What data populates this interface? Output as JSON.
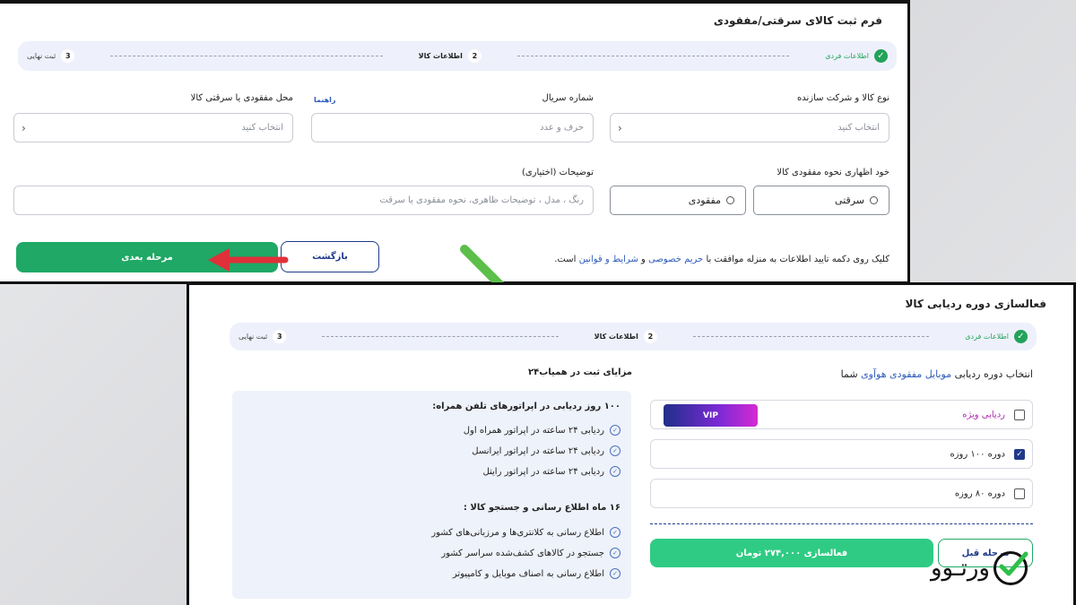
{
  "form1": {
    "title": "فرم ثبت کالای سرقتی/مفقودی",
    "steps": [
      {
        "num": "✓",
        "label": "اطلاعات فردی",
        "state": "done"
      },
      {
        "num": "2",
        "label": "اطلاعات کالا",
        "state": "active"
      },
      {
        "num": "3",
        "label": "ثبت نهایی",
        "state": "pending"
      }
    ],
    "fields": {
      "product_type": {
        "label": "نوع کالا و شرکت سازنده",
        "placeholder": "انتخاب کنید"
      },
      "serial": {
        "label": "شماره سریال",
        "placeholder": "حرف و عدد",
        "help": "راهنما"
      },
      "location": {
        "label": "محل مفقودی یا سرقتی کالا",
        "placeholder": "انتخاب کنید"
      },
      "loss_type": {
        "label": "خود اظهاری نحوه مفقودی کالا",
        "options": [
          "سرقتی",
          "مفقودی"
        ]
      },
      "description": {
        "label": "توضیحات (اختیاری)",
        "placeholder": "رنگ ، مدل ، توضیحات ظاهری، نحوه مفقودی یا سرقت"
      }
    },
    "consent": {
      "prefix": "کلیک روی دکمه تایید اطلاعات به منزله موافقت با",
      "privacy": "حریم خصوصی",
      "and": "و",
      "terms": "شرایط و قوانین",
      "suffix": "است."
    },
    "back_label": "بازگشت",
    "next_label": "مرحله بعدی"
  },
  "form2": {
    "title": "فعالسازی دوره ردیابی کالا",
    "steps": [
      {
        "num": "✓",
        "label": "اطلاعات فردی",
        "state": "done"
      },
      {
        "num": "2",
        "label": "اطلاعات کالا",
        "state": "active"
      },
      {
        "num": "3",
        "label": "ثبت نهایی",
        "state": "pending"
      }
    ],
    "select_prefix": "انتخاب دوره ردیابی",
    "select_device": "موبایل مفقودی هوآوی",
    "select_suffix": "شما",
    "plans": [
      {
        "label": "ردیابی ویژه",
        "badge": "VIP",
        "checked": false
      },
      {
        "label": "دوره ۱۰۰ روزه",
        "checked": true
      },
      {
        "label": "دوره ۸۰ روزه",
        "checked": false
      }
    ],
    "activate_label": "فعالسازی ۲۷۴,۰۰۰ تومان",
    "prev_label": "مرحله قبل",
    "benefits_title": "مزایای ثبت در همیاب۲۴",
    "group1_title": "۱۰۰ روز ردیابی در اپراتورهای تلفن همراه:",
    "group1_items": [
      "ردیابی ۲۴ ساعته در اپراتور همراه اول",
      "ردیابی ۲۴ ساعته در اپراتور ایرانسل",
      "ردیابی ۲۴ ساعته در اپراتور رایتل"
    ],
    "group2_title": "۱۶ ماه اطلاع رسانی و جستجو کالا :",
    "group2_items": [
      "اطلاع رسانی به کلانتری‌ها و مرزبانی‌های کشور",
      "جستجو در کالاهای کشف‌شده سراسر کشور",
      "اطلاع رسانی به اصناف موبایل و کامپیوتر"
    ]
  },
  "logo": {
    "text": "ورتـوو"
  },
  "colors": {
    "green": "#1fa866",
    "navy": "#1f3a8a",
    "red_arrow": "#e0303a",
    "green_arrow": "#5cbf4a"
  }
}
